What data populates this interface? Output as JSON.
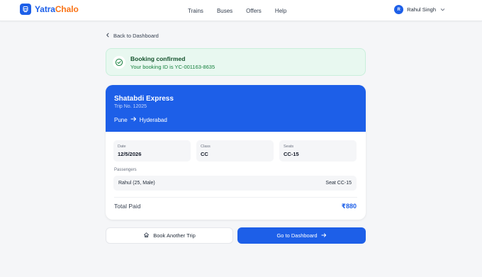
{
  "header": {
    "logo_part1": "Yatra",
    "logo_part2": "Chalo",
    "nav": [
      "Trains",
      "Buses",
      "Offers",
      "Help"
    ],
    "user_initial": "R",
    "user_name": "Rahul Singh"
  },
  "back_link": "Back to Dashboard",
  "alert": {
    "title": "Booking confirmed",
    "message": "Your booking ID is YC-001163-8635"
  },
  "ticket": {
    "train_name": "Shatabdi Express",
    "trip_no": "Trip No. 12025",
    "from": "Pune",
    "to": "Hyderabad",
    "details": [
      {
        "label": "Date",
        "value": "12/5/2026"
      },
      {
        "label": "Class",
        "value": "CC"
      },
      {
        "label": "Seats",
        "value": "CC-15"
      }
    ],
    "passengers_label": "Passengers",
    "passengers": [
      {
        "name": "Rahul (25, Male)",
        "seat": "Seat CC-15"
      }
    ],
    "total_label": "Total Paid",
    "total_value": "₹880"
  },
  "actions": {
    "secondary": "Book Another Trip",
    "primary": "Go to Dashboard"
  },
  "colors": {
    "brand_blue": "#1d5fe8",
    "brand_orange": "#f97316",
    "success_bg": "#e8f8f0"
  }
}
